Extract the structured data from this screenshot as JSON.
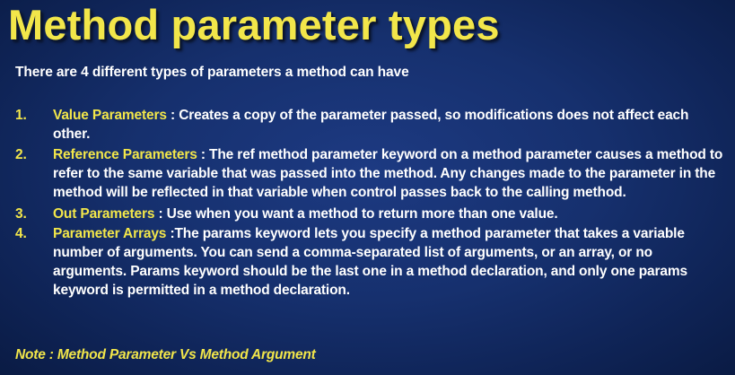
{
  "slide": {
    "title": "Method parameter types",
    "intro": "There are 4 different types of parameters a method can have",
    "items": [
      {
        "number": "1.",
        "term": "Value Parameters",
        "separator": " : ",
        "description": "Creates a copy of the parameter passed, so modifications does not affect each other."
      },
      {
        "number": "2.",
        "term": "Reference Parameters",
        "separator": " : ",
        "description": "The ref method parameter keyword on a method parameter causes a method to refer to the same variable that was passed into the method. Any changes made to the parameter in the method will be reflected in that variable when control passes back to the calling method."
      },
      {
        "number": "3.",
        "term": "Out Parameters",
        "separator": " : ",
        "description": "Use when you want a method to return more than one value."
      },
      {
        "number": "4.",
        "term": "Parameter Arrays",
        "separator": " :",
        "description": "The params keyword lets you specify a method parameter that takes a variable number of arguments. You can send a comma-separated list of arguments, or an array, or no arguments. Params keyword should be the last one in a method declaration, and only one params keyword is permitted in a method declaration."
      }
    ],
    "note": "Note : Method Parameter Vs Method Argument"
  },
  "colors": {
    "background": "#16306e",
    "accent_yellow": "#f2e64a",
    "body_text": "#ffffff"
  }
}
